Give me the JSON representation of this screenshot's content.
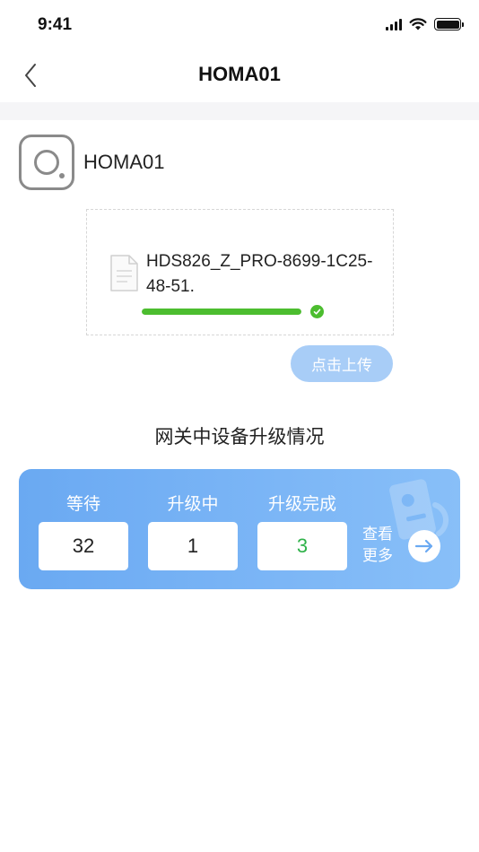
{
  "status_bar": {
    "time": "9:41"
  },
  "nav": {
    "title": "HOMA01"
  },
  "device": {
    "name": "HOMA01"
  },
  "firmware": {
    "file_name": "HDS826_Z_PRO-8699-1C25-48-51.",
    "progress": 1.0,
    "progress_color": "#4cbd2f"
  },
  "upload": {
    "label": "点击上传"
  },
  "section": {
    "title": "网关中设备升级情况"
  },
  "upgrade_status": {
    "waiting": {
      "label": "等待",
      "count": "32"
    },
    "upgrading": {
      "label": "升级中",
      "count": "1"
    },
    "completed": {
      "label": "升级完成",
      "count": "3"
    },
    "more_label": "查看更多"
  },
  "colors": {
    "accent": "#6aa9f2",
    "upload_button": "#a8cdf7",
    "success": "#2fb24a"
  }
}
